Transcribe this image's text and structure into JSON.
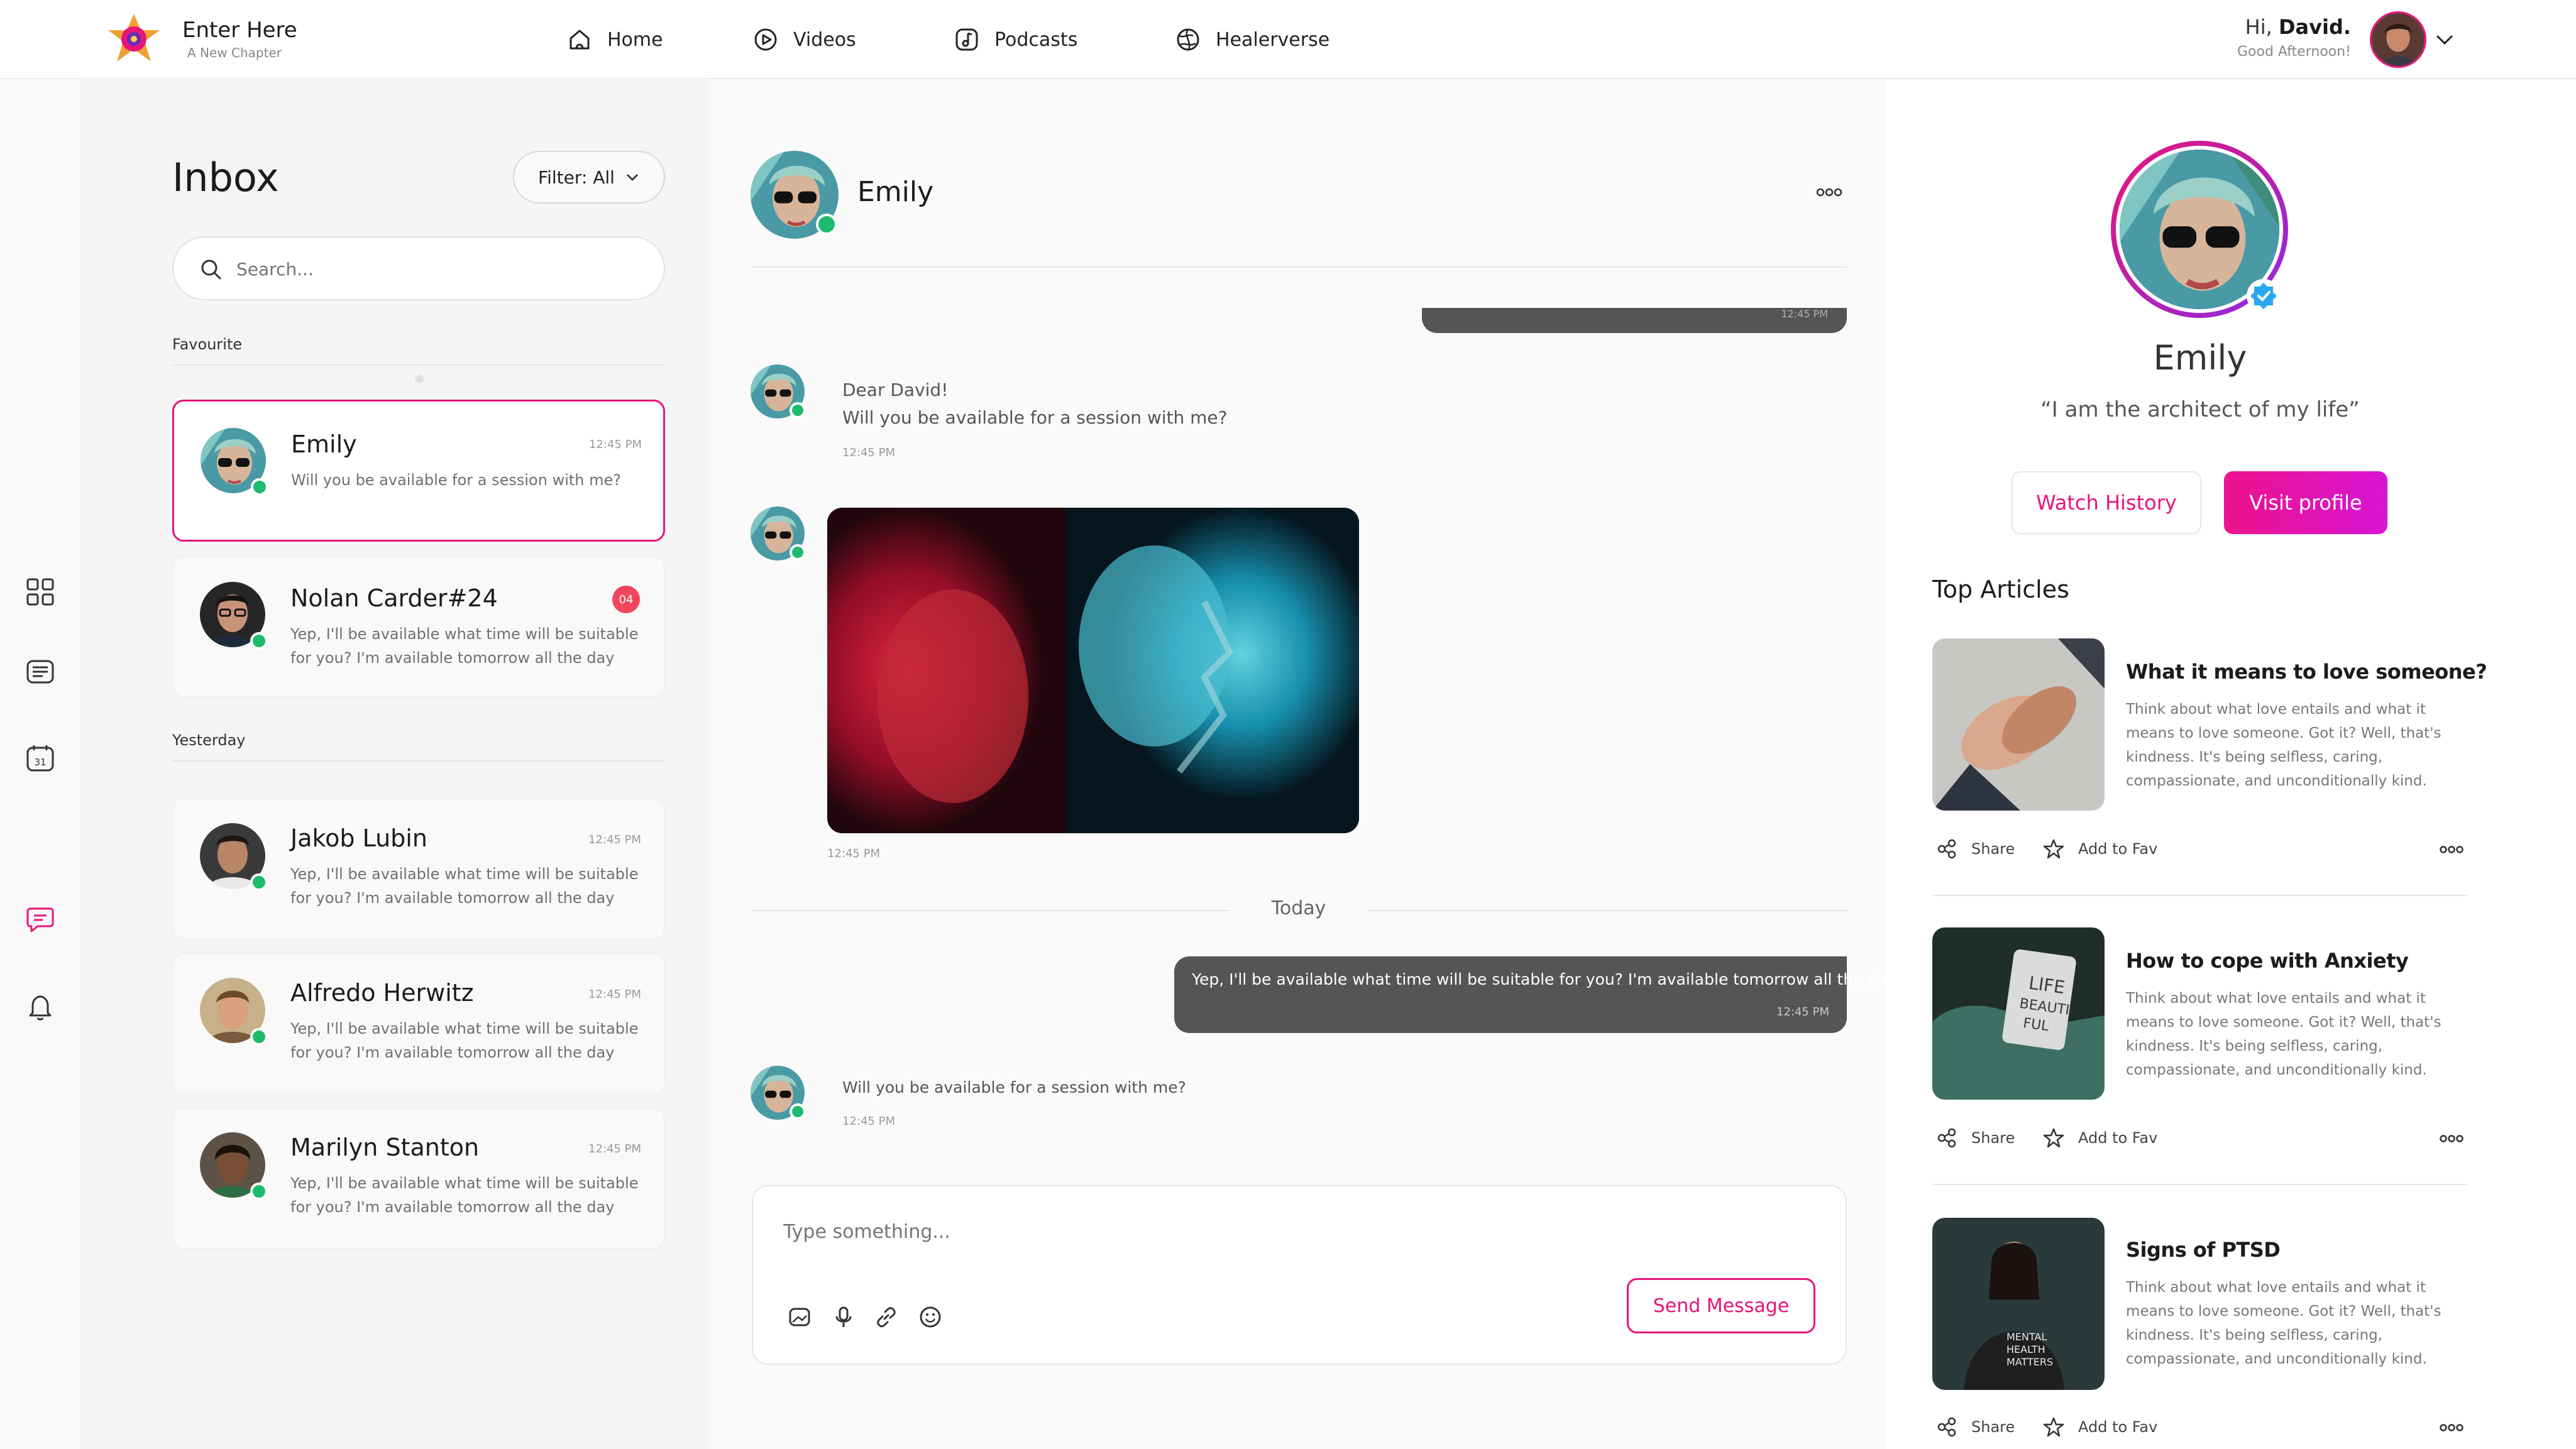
{
  "brand": {
    "name": "Enter Here",
    "tagline": "A New Chapter",
    "accent": "#e6157a"
  },
  "nav": [
    {
      "label": "Home",
      "icon": "home-icon"
    },
    {
      "label": "Videos",
      "icon": "play-icon"
    },
    {
      "label": "Podcasts",
      "icon": "music-note-icon"
    },
    {
      "label": "Healerverse",
      "icon": "globe-icon"
    }
  ],
  "user": {
    "greeting": "Hi,",
    "name": "David.",
    "subtext": "Good Afternoon!"
  },
  "sidebar": [
    {
      "icon": "grid-icon"
    },
    {
      "icon": "list-icon"
    },
    {
      "icon": "calendar-icon",
      "text": "31"
    },
    {
      "icon": "chat-icon",
      "active": true
    },
    {
      "icon": "bell-icon"
    }
  ],
  "inbox": {
    "title": "Inbox",
    "filter": "Filter: All",
    "search_placeholder": "Search...",
    "favourite_label": "Favourite",
    "yesterday_label": "Yesterday",
    "conversations": [
      {
        "name": "Emily",
        "time": "12:45 PM",
        "message": "Will you be available for a session with me?",
        "online": true,
        "selected": true
      },
      {
        "name": "Nolan Carder#24",
        "badge": "04",
        "message": "Yep, I'll be available what time will be suitable for you? I'm available tomorrow all the day",
        "online": true
      },
      {
        "name": "Jakob Lubin",
        "time": "12:45 PM",
        "message": "Yep, I'll be available what time will be suitable for you? I'm available tomorrow all the day",
        "online": true
      },
      {
        "name": "Alfredo Herwitz",
        "time": "12:45 PM",
        "message": "Yep, I'll be available what time will be suitable for you? I'm available tomorrow all the day",
        "online": true
      },
      {
        "name": "Marilyn Stanton",
        "time": "12:45 PM",
        "message": "Yep, I'll be available what time will be suitable for you? I'm available tomorrow all the day",
        "online": true
      }
    ]
  },
  "chat": {
    "contact": "Emily",
    "top_time": "12:45 PM",
    "msg1_line1": "Dear David!",
    "msg1_line2": "Will you be available for a session with me?",
    "msg1_time": "12:45 PM",
    "img_time": "12:45 PM",
    "day_divider": "Today",
    "outgoing": "Yep, I'll be available what time will be suitable for you? I'm available tomorrow all the day",
    "outgoing_time": "12:45 PM",
    "msg3": "Will you be available for a session with me?",
    "msg3_time": "12:45 PM",
    "compose_placeholder": "Type something...",
    "send_label": "Send Message"
  },
  "profile": {
    "name": "Emily",
    "quote": "“I am the architect of my life”",
    "watch_history": "Watch History",
    "visit_profile": "Visit profile",
    "articles_heading": "Top Articles",
    "share_label": "Share",
    "fav_label": "Add to Fav",
    "articles": [
      {
        "title": "What it means to love someone?",
        "text": "Think about what love entails and what it means to love someone. Got it? Well, that's kindness. It's being selfless, caring, compassionate, and unconditionally kind."
      },
      {
        "title": "How to cope with Anxiety",
        "text": "Think about what love entails and what it means to love someone. Got it? Well, that's kindness. It's being selfless, caring, compassionate, and unconditionally kind."
      },
      {
        "title": "Signs of PTSD",
        "text": "Think about what love entails and what it means to love someone. Got it? Well, that's kindness. It's being selfless, caring, compassionate, and unconditionally kind."
      }
    ]
  }
}
